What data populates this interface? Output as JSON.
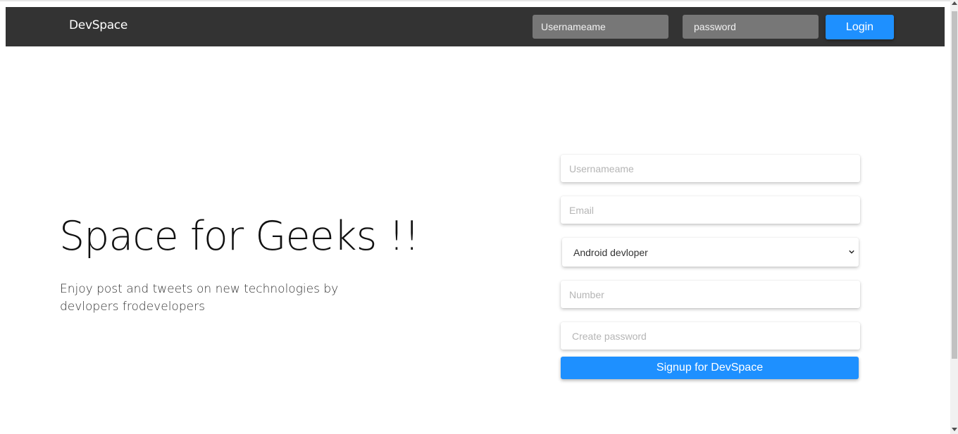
{
  "navbar": {
    "brand": "DevSpace",
    "username_placeholder": "Usernameame",
    "password_placeholder": "password",
    "login_label": "Login"
  },
  "hero": {
    "title": "Space for Geeks !!",
    "subtitle": "Enjoy post and tweets on new technologies by devlopers frodevelopers"
  },
  "signup": {
    "username_placeholder": "Usernameame",
    "email_placeholder": "Email",
    "role_selected": "Android devloper",
    "number_placeholder": "Number",
    "password_placeholder": "Create password",
    "submit_label": "Signup for DevSpace"
  },
  "colors": {
    "navbar_bg": "#333333",
    "accent": "#1e90ff",
    "nav_input_bg": "#777777"
  },
  "icons": {
    "select_arrow": "chevron-down-icon"
  }
}
